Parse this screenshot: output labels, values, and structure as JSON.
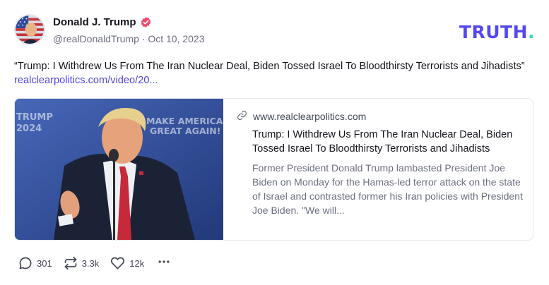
{
  "author": {
    "display_name": "Donald J. Trump",
    "handle": "@realDonaldTrump",
    "separator": "·",
    "date": "Oct 10, 2023"
  },
  "brand": {
    "name": "TRUTH",
    "dot": ".",
    "color": "#5448ee",
    "dot_color": "#3ad6c5"
  },
  "post": {
    "text": "“Trump: I Withdrew Us From The Iran Nuclear Deal, Biden Tossed Israel To Bloodthirsty Terrorists and Jihadists”",
    "link_text": "realclearpolitics.com/video/20..."
  },
  "card": {
    "image_sign_left": [
      "TRUMP",
      "2024"
    ],
    "image_sign_right": [
      "MAKE AMERICA",
      "GREAT AGAIN!"
    ],
    "domain": "www.realclearpolitics.com",
    "title": "Trump: I Withdrew Us From The Iran Nuclear Deal, Biden Tossed Israel To Bloodthirsty Terrorists and Jihadists",
    "description": "Former President Donald Trump lambasted President Joe Biden on Monday for the Hamas-led terror attack on the state of Israel and contrasted former his Iran policies with President Joe Biden. \"We will..."
  },
  "actions": {
    "replies": "301",
    "retruths": "3.3k",
    "likes": "12k"
  },
  "icons": [
    "verified-badge-icon",
    "link-icon",
    "reply-icon",
    "retruth-icon",
    "like-icon",
    "more-icon"
  ]
}
